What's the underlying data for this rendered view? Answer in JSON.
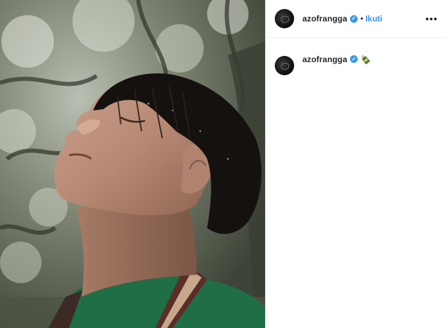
{
  "post": {
    "photo_alt": "",
    "header": {
      "username": "azofrangga",
      "verified": true,
      "separator": "•",
      "follow_label": "Ikuti",
      "more_label": "•••"
    },
    "caption": {
      "username": "azofrangga",
      "verified": true,
      "emoji": "bottle-emoji"
    }
  },
  "colors": {
    "link_blue": "#3897f0",
    "text_dark": "#262626",
    "divider": "#efefef"
  }
}
